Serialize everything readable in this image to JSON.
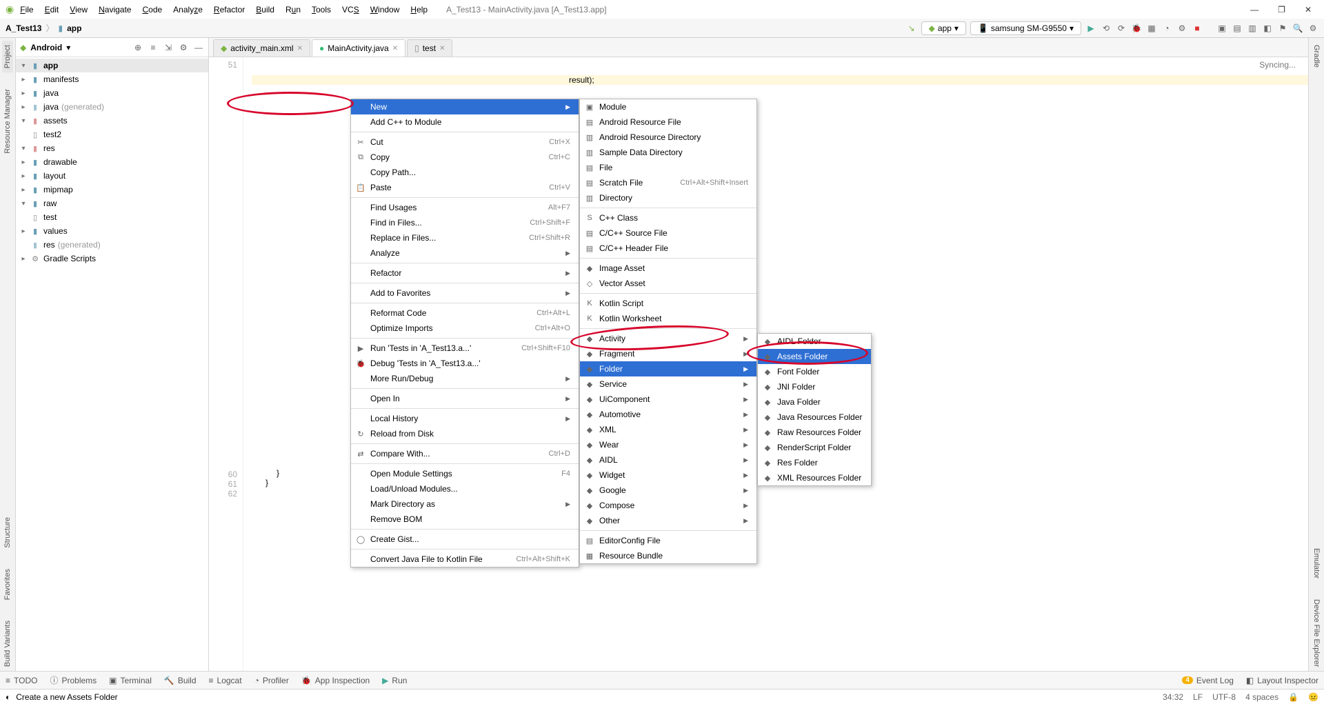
{
  "menubar": {
    "items": [
      "File",
      "Edit",
      "View",
      "Navigate",
      "Code",
      "Analyze",
      "Refactor",
      "Build",
      "Run",
      "Tools",
      "VCS",
      "Window",
      "Help"
    ],
    "title": "A_Test13 - MainActivity.java [A_Test13.app]"
  },
  "breadcrumb": {
    "p0": "A_Test13",
    "p1": "app"
  },
  "runconfig": {
    "app": "app",
    "device": "samsung SM-G9550"
  },
  "projhdr": {
    "mode": "Android"
  },
  "tree": {
    "app": "app",
    "manifests": "manifests",
    "java": "java",
    "javagen": "java",
    "gen": "(generated)",
    "assets": "assets",
    "test2": "test2",
    "res": "res",
    "drawable": "drawable",
    "layout": "layout",
    "mipmap": "mipmap",
    "raw": "raw",
    "test": "test",
    "values": "values",
    "resgen": "res",
    "gradle": "Gradle Scripts"
  },
  "tabs": {
    "t1": "activity_main.xml",
    "t2": "MainActivity.java",
    "t3": "test"
  },
  "gutter": {
    "l1": "51",
    "l2": "60",
    "l3": "61",
    "l4": "62"
  },
  "code": {
    "frag": "result);",
    "b1": "}",
    "b2": "}",
    "sync": "Syncing..."
  },
  "ctx1": [
    {
      "t": "New",
      "sub": true,
      "hi": true
    },
    {
      "t": "Add C++ to Module"
    },
    {
      "sep": true
    },
    {
      "t": "Cut",
      "sc": "Ctrl+X",
      "ic": "✂"
    },
    {
      "t": "Copy",
      "sc": "Ctrl+C",
      "ic": "⧉"
    },
    {
      "t": "Copy Path..."
    },
    {
      "t": "Paste",
      "sc": "Ctrl+V",
      "ic": "📋"
    },
    {
      "sep": true
    },
    {
      "t": "Find Usages",
      "sc": "Alt+F7"
    },
    {
      "t": "Find in Files...",
      "sc": "Ctrl+Shift+F"
    },
    {
      "t": "Replace in Files...",
      "sc": "Ctrl+Shift+R"
    },
    {
      "t": "Analyze",
      "sub": true
    },
    {
      "sep": true
    },
    {
      "t": "Refactor",
      "sub": true
    },
    {
      "sep": true
    },
    {
      "t": "Add to Favorites",
      "sub": true
    },
    {
      "sep": true
    },
    {
      "t": "Reformat Code",
      "sc": "Ctrl+Alt+L"
    },
    {
      "t": "Optimize Imports",
      "sc": "Ctrl+Alt+O"
    },
    {
      "sep": true
    },
    {
      "t": "Run 'Tests in 'A_Test13.a...'",
      "sc": "Ctrl+Shift+F10",
      "ic": "▶"
    },
    {
      "t": "Debug 'Tests in 'A_Test13.a...'",
      "ic": "🐞"
    },
    {
      "t": "More Run/Debug",
      "sub": true
    },
    {
      "sep": true
    },
    {
      "t": "Open In",
      "sub": true
    },
    {
      "sep": true
    },
    {
      "t": "Local History",
      "sub": true
    },
    {
      "t": "Reload from Disk",
      "ic": "↻"
    },
    {
      "sep": true
    },
    {
      "t": "Compare With...",
      "sc": "Ctrl+D",
      "ic": "⇄"
    },
    {
      "sep": true
    },
    {
      "t": "Open Module Settings",
      "sc": "F4"
    },
    {
      "t": "Load/Unload Modules..."
    },
    {
      "t": "Mark Directory as",
      "sub": true
    },
    {
      "t": "Remove BOM"
    },
    {
      "sep": true
    },
    {
      "t": "Create Gist...",
      "ic": "◯"
    },
    {
      "sep": true
    },
    {
      "t": "Convert Java File to Kotlin File",
      "sc": "Ctrl+Alt+Shift+K"
    }
  ],
  "ctx2": [
    {
      "t": "Module",
      "ic": "▣"
    },
    {
      "t": "Android Resource File",
      "ic": "▤"
    },
    {
      "t": "Android Resource Directory",
      "ic": "▥"
    },
    {
      "t": "Sample Data Directory",
      "ic": "▥"
    },
    {
      "t": "File",
      "ic": "▤"
    },
    {
      "t": "Scratch File",
      "sc": "Ctrl+Alt+Shift+Insert",
      "ic": "▤"
    },
    {
      "t": "Directory",
      "ic": "▥"
    },
    {
      "sep": true
    },
    {
      "t": "C++ Class",
      "ic": "S"
    },
    {
      "t": "C/C++ Source File",
      "ic": "▤"
    },
    {
      "t": "C/C++ Header File",
      "ic": "▤"
    },
    {
      "sep": true
    },
    {
      "t": "Image Asset",
      "ic": "◆"
    },
    {
      "t": "Vector Asset",
      "ic": "◇"
    },
    {
      "sep": true
    },
    {
      "t": "Kotlin Script",
      "ic": "K"
    },
    {
      "t": "Kotlin Worksheet",
      "ic": "K"
    },
    {
      "sep": true
    },
    {
      "t": "Activity",
      "sub": true,
      "ic": "◆"
    },
    {
      "t": "Fragment",
      "sub": true,
      "ic": "◆"
    },
    {
      "t": "Folder",
      "sub": true,
      "hi": true,
      "ic": "◆"
    },
    {
      "t": "Service",
      "sub": true,
      "ic": "◆"
    },
    {
      "t": "UiComponent",
      "sub": true,
      "ic": "◆"
    },
    {
      "t": "Automotive",
      "sub": true,
      "ic": "◆"
    },
    {
      "t": "XML",
      "sub": true,
      "ic": "◆"
    },
    {
      "t": "Wear",
      "sub": true,
      "ic": "◆"
    },
    {
      "t": "AIDL",
      "sub": true,
      "ic": "◆"
    },
    {
      "t": "Widget",
      "sub": true,
      "ic": "◆"
    },
    {
      "t": "Google",
      "sub": true,
      "ic": "◆"
    },
    {
      "t": "Compose",
      "sub": true,
      "ic": "◆"
    },
    {
      "t": "Other",
      "sub": true,
      "ic": "◆"
    },
    {
      "sep": true
    },
    {
      "t": "EditorConfig File",
      "ic": "▤"
    },
    {
      "t": "Resource Bundle",
      "ic": "▦"
    }
  ],
  "ctx3": [
    {
      "t": "AIDL Folder",
      "ic": "◆"
    },
    {
      "t": "Assets Folder",
      "hi": true,
      "ic": "◆"
    },
    {
      "t": "Font Folder",
      "ic": "◆"
    },
    {
      "t": "JNI Folder",
      "ic": "◆"
    },
    {
      "t": "Java Folder",
      "ic": "◆"
    },
    {
      "t": "Java Resources Folder",
      "ic": "◆"
    },
    {
      "t": "Raw Resources Folder",
      "ic": "◆"
    },
    {
      "t": "RenderScript Folder",
      "ic": "◆"
    },
    {
      "t": "Res Folder",
      "ic": "◆"
    },
    {
      "t": "XML Resources Folder",
      "ic": "◆"
    }
  ],
  "leftrail": {
    "project": "Project",
    "resmgr": "Resource Manager",
    "struct": "Structure",
    "fav": "Favorites",
    "bv": "Build Variants"
  },
  "rightrail": {
    "gradle": "Gradle",
    "emu": "Emulator",
    "dfe": "Device File Explorer"
  },
  "bottom": {
    "todo": "TODO",
    "problems": "Problems",
    "terminal": "Terminal",
    "build": "Build",
    "logcat": "Logcat",
    "profiler": "Profiler",
    "appinsp": "App Inspection",
    "run": "Run",
    "eventlog": "Event Log",
    "layoutinsp": "Layout Inspector"
  },
  "status": {
    "msg": "Create a new Assets Folder",
    "pos": "34:32",
    "le": "LF",
    "enc": "UTF-8",
    "indent": "4 spaces",
    "branch": "",
    "badge": "4"
  }
}
